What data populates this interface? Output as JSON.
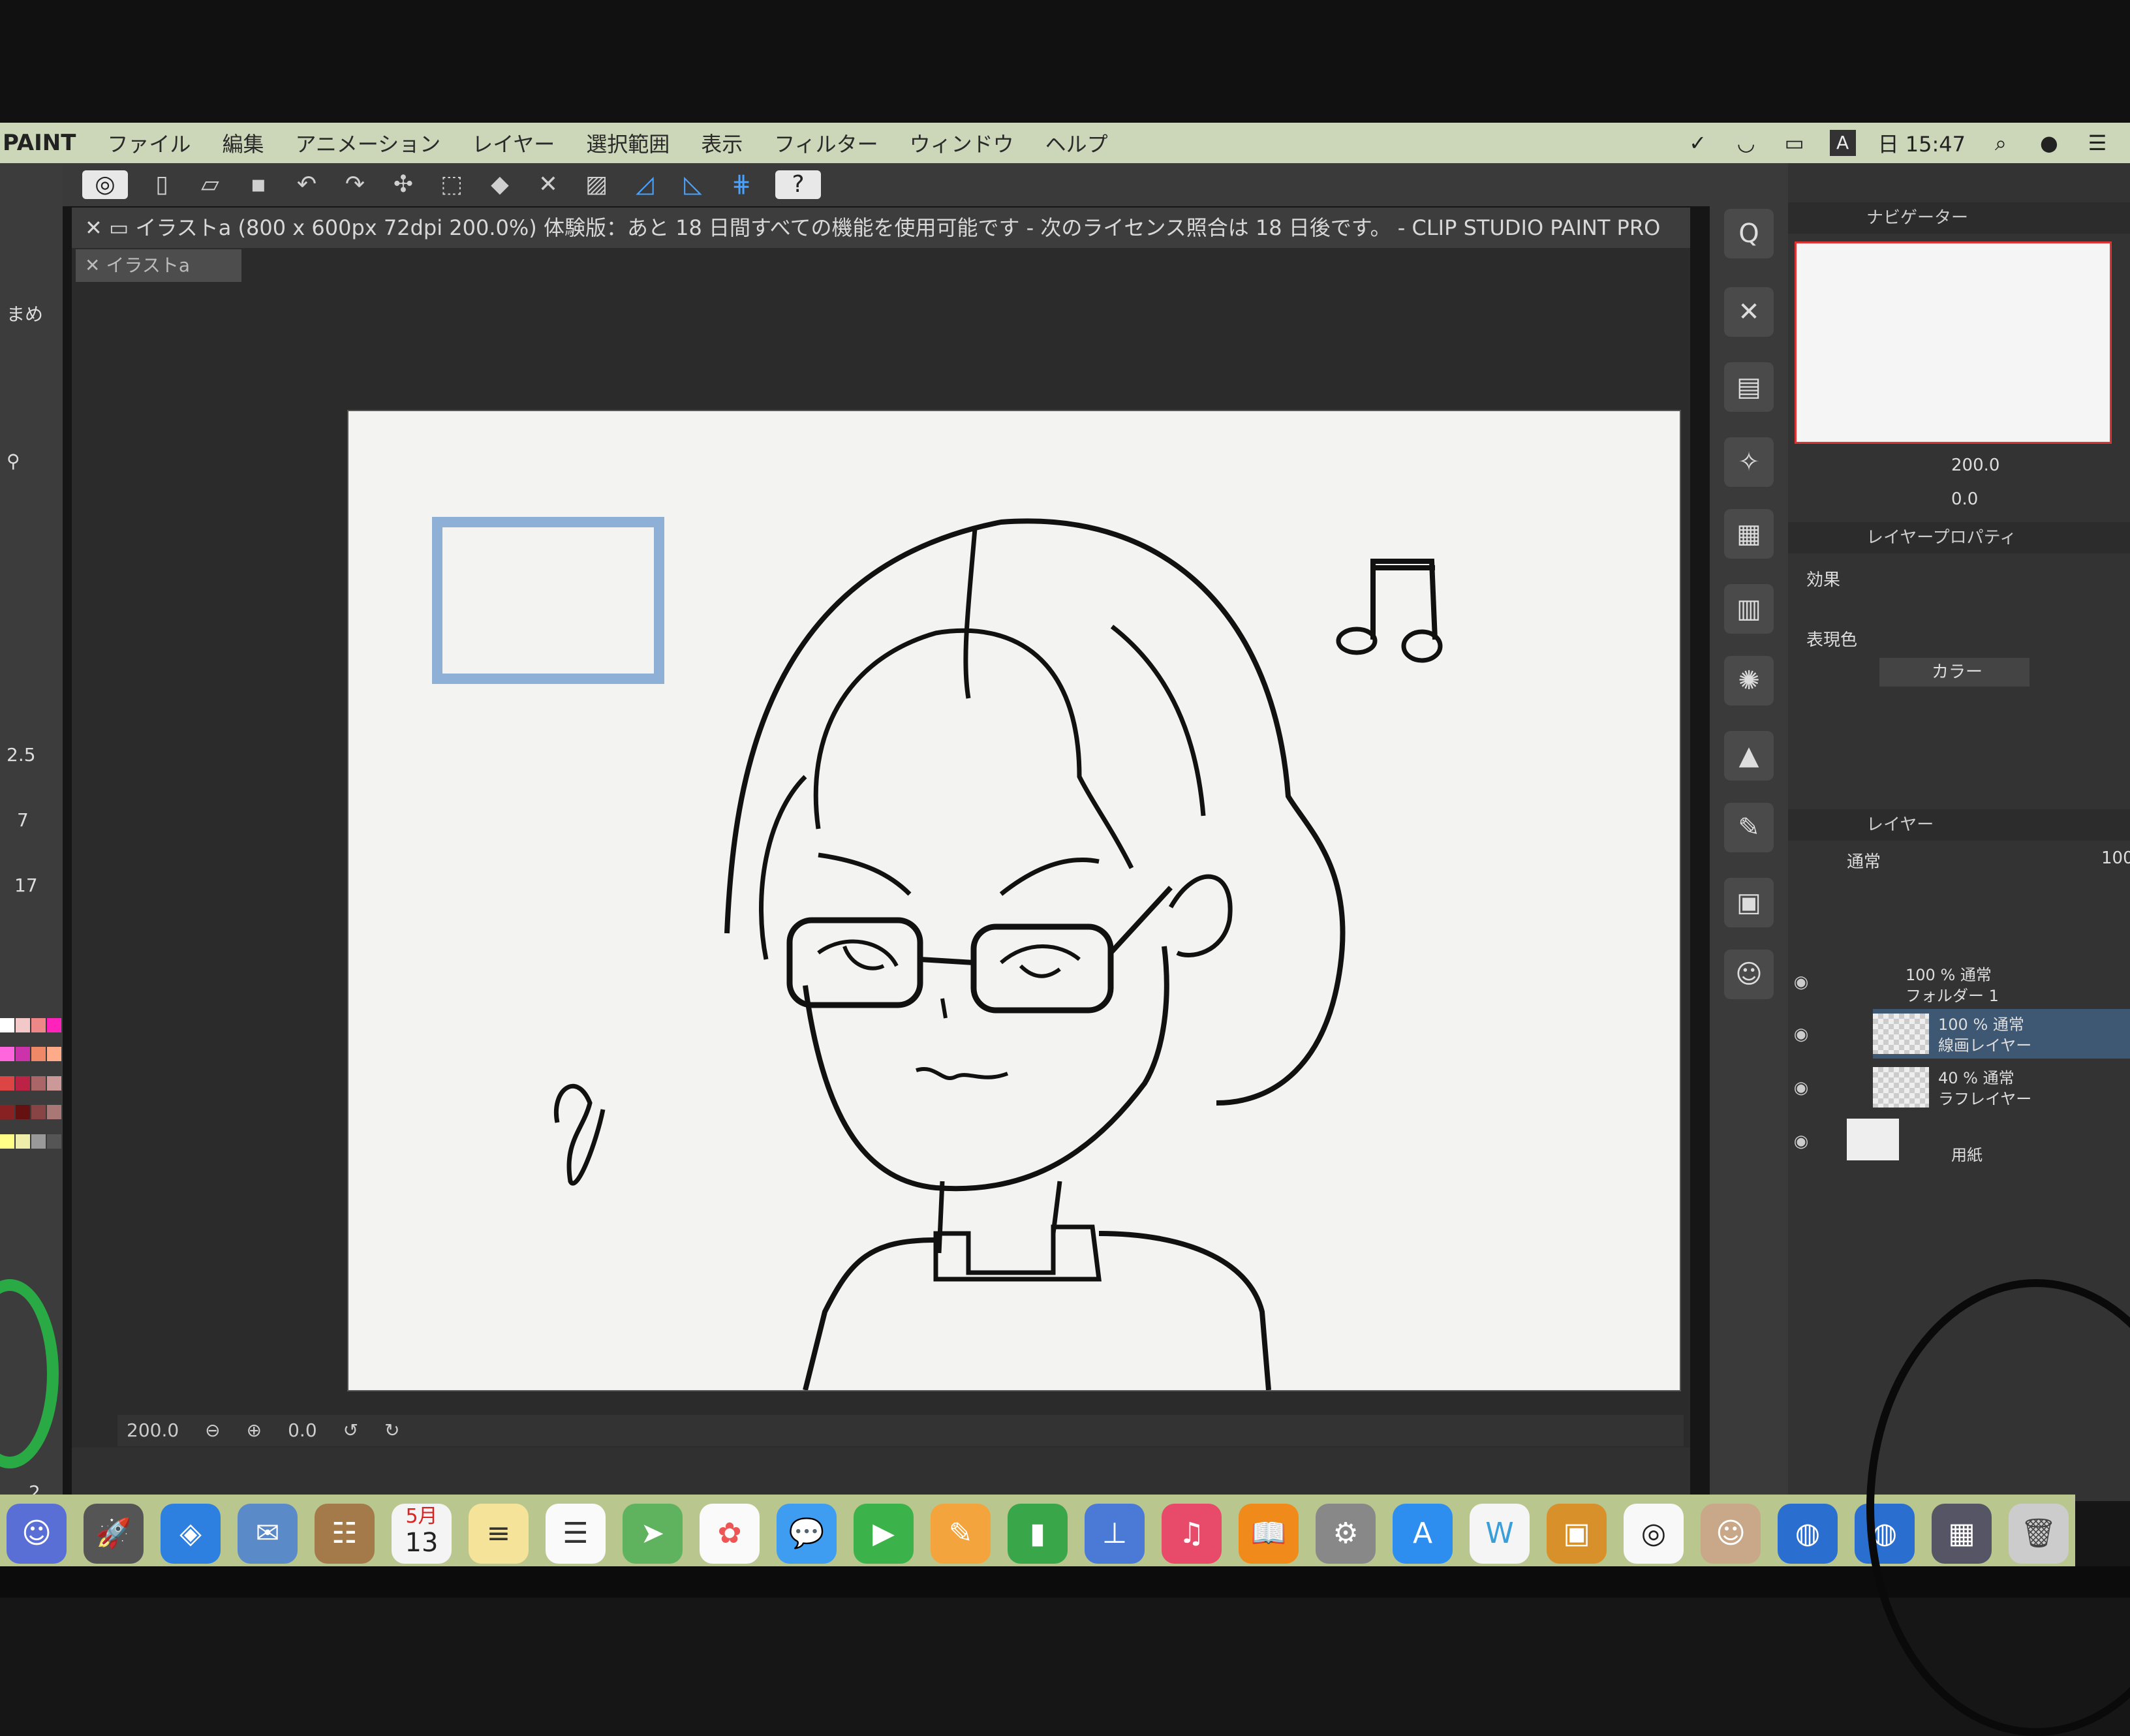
{
  "menubar": {
    "app_name": "PAINT",
    "items": [
      "ファイル",
      "編集",
      "アニメーション",
      "レイヤー",
      "選択範囲",
      "表示",
      "フィルター",
      "ウィンドウ",
      "ヘルプ"
    ],
    "input_indicator": "A",
    "clock": "日 15:47"
  },
  "document": {
    "title": "イラストa (800 x 600px 72dpi 200.0%)  体験版：あと 18 日間すべての機能を使用可能です - 次のライセンス照合は 18 日後です。 - CLIP STUDIO PAINT PRO",
    "tab_label": "イラストa"
  },
  "statusbar": {
    "zoom": "200.0",
    "rotation": "0.0"
  },
  "left_dock": {
    "labels": [
      "2.5",
      "7",
      "17",
      "2"
    ],
    "top_label": "まめ"
  },
  "navigator": {
    "title": "ナビゲーター",
    "zoom": "200.0",
    "angle": "0.0"
  },
  "layer_property": {
    "title": "レイヤープロパティ",
    "effect_label": "効果",
    "expression_color_label": "表現色",
    "expression_color_value": "カラー"
  },
  "layer_panel": {
    "title": "レイヤー",
    "blend_mode": "通常",
    "opacity_prefix": "100",
    "layers": [
      {
        "line1": "100 % 通常",
        "line2": "フォルダー 1"
      },
      {
        "line1": "100 % 通常",
        "line2": "線画レイヤー"
      },
      {
        "line1": "40 % 通常",
        "line2": "ラフレイヤー"
      },
      {
        "line1": "",
        "line2": "用紙"
      }
    ]
  },
  "dock": {
    "calendar_month": "5月",
    "calendar_day": "13"
  },
  "colors": {
    "menubar_bg": "#ccd6b8",
    "dock_bg": "#b9c78e",
    "selected_layer": "#3e5873",
    "sketch_blue": "#8fb0d6"
  }
}
